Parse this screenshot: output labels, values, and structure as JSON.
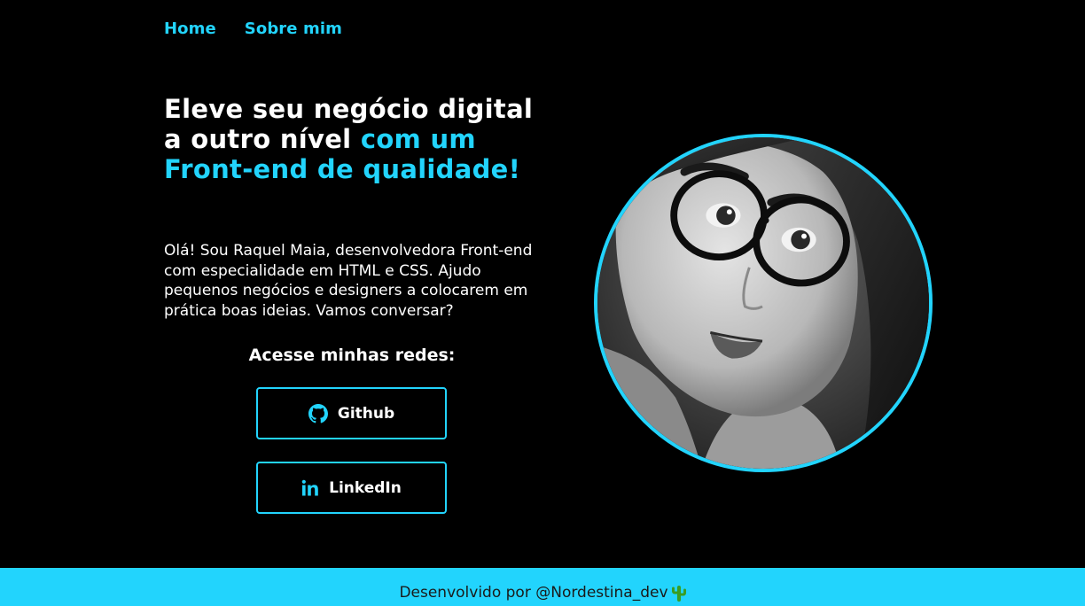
{
  "nav": {
    "home_label": "Home",
    "about_label": "Sobre mim"
  },
  "hero": {
    "headline_white": "Eleve seu negócio digital a outro nível",
    "headline_accent": "com um Front-end de qualidade!",
    "intro": "Olá! Sou Raquel Maia, desenvolvedora Front-end com especialidade em HTML e CSS. Ajudo pequenos negócios e designers a colocarem em prática boas ideias. Vamos conversar?",
    "social_title": "Acesse minhas redes:"
  },
  "social": {
    "github_label": "Github",
    "github_icon": "github-icon",
    "linkedin_label": "LinkedIn",
    "linkedin_icon": "linkedin-icon"
  },
  "footer": {
    "text": "Desenvolvido por @Nordestina_dev",
    "icon": "cactus-icon"
  },
  "colors": {
    "accent": "#22d4fd",
    "background": "#000000",
    "text": "#ffffff",
    "footer_text": "#1a1a1a"
  }
}
